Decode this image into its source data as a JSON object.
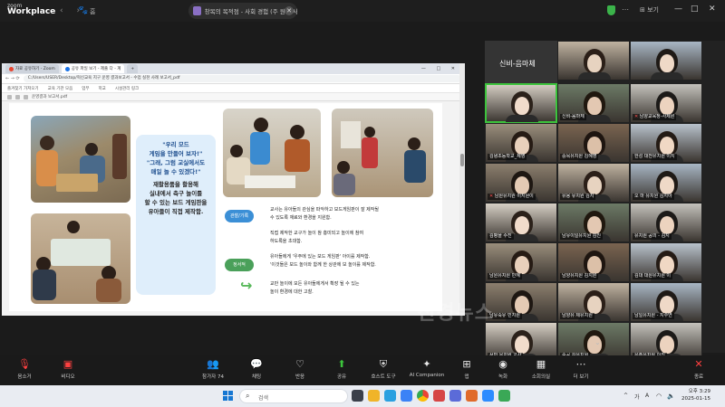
{
  "app": {
    "brand_top": "zoom",
    "brand_name": "Workplace",
    "paw_label": "홈",
    "meeting_title": "창목의 목적점 - 사회 경험 (주 원의 사주)...",
    "view_label": "보기",
    "win_controls": [
      "—",
      "□",
      "✕"
    ]
  },
  "browser": {
    "tabs": [
      "자료 공유하기 - Zoom",
      "공유 파일 보기 - 제출 다 - 계",
      ""
    ],
    "url": "C:/Users/USER/Desktop/혁신교육 지구 운영 결과보고서 - 수업 실천 사례 보고서_pdf",
    "bookmarks": [
      "즐겨찾기 가져오기",
      "교육 기관 모음",
      "업무",
      "학교",
      "시설관리 링크"
    ],
    "pdf_file": "운영결과 보고서.pdf"
  },
  "document": {
    "quote_lines": [
      "\"우리 모드",
      "게임을 만들어 보자!\"",
      "\"그래, 그럼 교실에서도",
      "매일 놀 수 있겠다!\""
    ],
    "quote_body": [
      "재활용품을 활용해",
      "실내에서 축구 놀이를",
      "할 수 있는 보드 게임판을",
      "유아들이 직접 제작함."
    ],
    "tag1": "관찰/기록",
    "tag2": "정서적",
    "para1": [
      "교사는 유아들의 관심을 파악하고 보드게임판이 잘 제작될",
      "수 있도록 재료와 환경을 지원함."
    ],
    "para2": [
      "직접 제작한 교구가 놀이 참 흥미되고 놀이에 참여",
      "하도록을 초대함."
    ],
    "para3": [
      "유아들에게 '우주에 있는 보드 게임판' 아이를 제작함.",
      "'이것들은 보드 놀이와 함께 한 상관에 보 놀이를 제작함."
    ],
    "para4": [
      "교만 놀이에 모든 유아들에게서 확장 될 수 있는",
      "놀이 환경에 대한 고찰."
    ]
  },
  "gallery": {
    "panel_name": "신비-음마체",
    "tiles": [
      {
        "name": "",
        "mic_off": false
      },
      {
        "name": "",
        "mic_off": false
      },
      {
        "name": "",
        "mic_off": false
      },
      {
        "name": "신비-음마체",
        "mic_off": false
      },
      {
        "name": "남양교육청-사제원",
        "mic_off": true
      },
      {
        "name": "김녕초등학교_제영",
        "mic_off": false
      },
      {
        "name": "숭목유치원 김혜영",
        "mic_off": false
      },
      {
        "name": "한성 대전유치원 이지",
        "mic_off": false
      },
      {
        "name": "남원유치원 이지원이",
        "mic_off": true
      },
      {
        "name": "유용 유치원 김지",
        "mic_off": false
      },
      {
        "name": "오 마 유치원 김지아",
        "mic_off": false
      },
      {
        "name": "김평을 수진",
        "mic_off": false
      },
      {
        "name": "남유이일유치원 김진",
        "mic_off": false
      },
      {
        "name": "유치원 공의 - 김지",
        "mic_off": false
      },
      {
        "name": "남원유치원 민혜",
        "mic_off": false
      },
      {
        "name": "남양유치원 김지원",
        "mic_off": false
      },
      {
        "name": "김대 대원유치원 이",
        "mic_off": false
      },
      {
        "name": "남유숙유 민지원",
        "mic_off": false
      },
      {
        "name": "남양유 제유치원",
        "mic_off": false
      },
      {
        "name": "남일유치원 - 지수연",
        "mic_off": false
      },
      {
        "name": "서빈 유치원 교사",
        "mic_off": false
      },
      {
        "name": "숭공 김유치원",
        "mic_off": false
      },
      {
        "name": "유주유치원 이진",
        "mic_off": false
      },
      {
        "name": "유주유 유치원 김혜",
        "mic_off": false
      }
    ]
  },
  "watermark": "신경뉴스",
  "controls": [
    {
      "label": "음소거",
      "icon": "mic-icon"
    },
    {
      "label": "비디오",
      "icon": "video-icon"
    },
    {
      "label": "참가자 74",
      "icon": "participants-icon"
    },
    {
      "label": "채팅",
      "icon": "chat-icon"
    },
    {
      "label": "반응",
      "icon": "reaction-icon"
    },
    {
      "label": "공유",
      "icon": "share-icon"
    },
    {
      "label": "호스트 도구",
      "icon": "host-tools-icon"
    },
    {
      "label": "AI Companion",
      "icon": "ai-companion-icon"
    },
    {
      "label": "앱",
      "icon": "apps-icon"
    },
    {
      "label": "녹화",
      "icon": "record-icon"
    },
    {
      "label": "소회의실",
      "icon": "breakout-icon"
    },
    {
      "label": "더 보기",
      "icon": "more-icon"
    },
    {
      "label": "종료",
      "icon": "end-icon"
    }
  ],
  "taskbar": {
    "search_placeholder": "검색",
    "tray": [
      "^",
      "가",
      "A"
    ],
    "time": "오후 3:29",
    "date": "2025-01-15"
  },
  "colors": {
    "active_speaker": "#3cc43c",
    "end_button": "#e8303a",
    "tag_blue": "#3b8fd6",
    "quote_bg": "#dfeefb"
  }
}
